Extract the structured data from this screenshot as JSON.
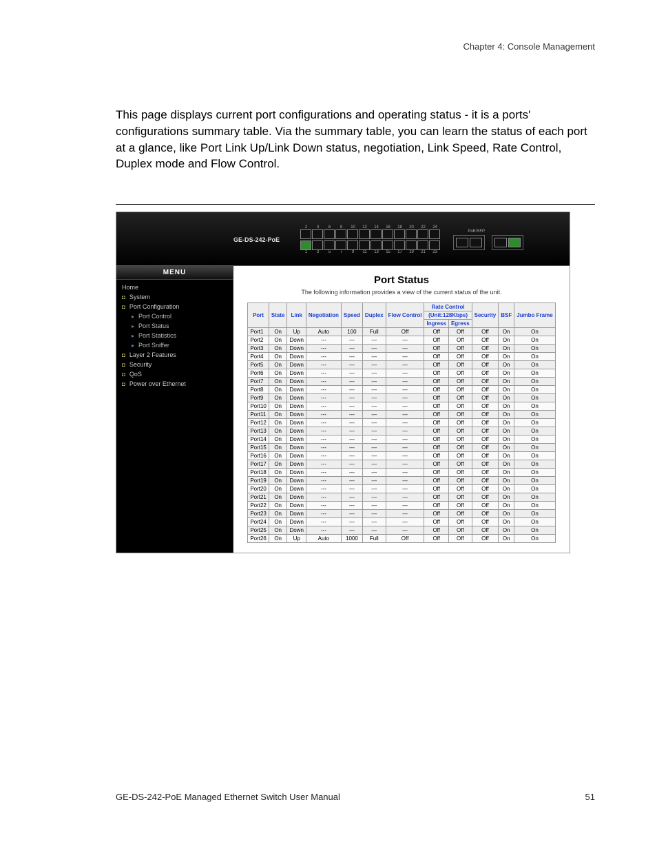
{
  "chapter_header": "Chapter 4: Console Management",
  "body_paragraph": "This page displays current port configurations and operating status - it is a ports' configurations summary table. Via the summary table, you can learn the status of each port at a glance, like Port Link Up/Link Down status, negotiation, Link Speed, Rate Control, Duplex mode and Flow Control.",
  "device_model": "GE-DS-242-PoE",
  "top_port_numbers": [
    "2",
    "4",
    "6",
    "8",
    "10",
    "12",
    "14",
    "16",
    "18",
    "20",
    "22",
    "24"
  ],
  "bottom_port_numbers": [
    "1",
    "3",
    "5",
    "7",
    "9",
    "11",
    "13",
    "15",
    "17",
    "19",
    "21",
    "23"
  ],
  "sfp_label": "PoE/SFP",
  "menu": {
    "title": "MENU",
    "items": [
      {
        "label": "Home",
        "type": "top"
      },
      {
        "label": "System",
        "type": "top",
        "bullet": "sq"
      },
      {
        "label": "Port Configuration",
        "type": "top",
        "bullet": "sq"
      },
      {
        "label": "Port Control",
        "type": "sub",
        "bullet": "tri"
      },
      {
        "label": "Port Status",
        "type": "sub",
        "bullet": "tri"
      },
      {
        "label": "Port Statistics",
        "type": "sub",
        "bullet": "tri"
      },
      {
        "label": "Port Sniffer",
        "type": "sub",
        "bullet": "tri"
      },
      {
        "label": "Layer 2 Features",
        "type": "top",
        "bullet": "sq"
      },
      {
        "label": "Security",
        "type": "top",
        "bullet": "sq"
      },
      {
        "label": "QoS",
        "type": "top",
        "bullet": "sq"
      },
      {
        "label": "Power over Ethernet",
        "type": "top",
        "bullet": "sq"
      }
    ]
  },
  "content": {
    "title": "Port Status",
    "subtitle": "The following information provides a view of the current status of the unit.",
    "headers": {
      "port": "Port",
      "state": "State",
      "link": "Link",
      "negotiation": "Negotiation",
      "speed": "Speed",
      "duplex": "Duplex",
      "flow": "Flow Control",
      "rate_group": "Rate Control",
      "rate_unit": "(Unit:128Kbps)",
      "ingress": "Ingress",
      "egress": "Egress",
      "security": "Security",
      "bsf": "BSF",
      "jumbo": "Jumbo Frame"
    },
    "rows": [
      {
        "port": "Port1",
        "state": "On",
        "link": "Up",
        "neg": "Auto",
        "speed": "100",
        "duplex": "Full",
        "flow": "Off",
        "ing": "Off",
        "egr": "Off",
        "sec": "Off",
        "bsf": "On",
        "jumbo": "On"
      },
      {
        "port": "Port2",
        "state": "On",
        "link": "Down",
        "neg": "---",
        "speed": "---",
        "duplex": "---",
        "flow": "---",
        "ing": "Off",
        "egr": "Off",
        "sec": "Off",
        "bsf": "On",
        "jumbo": "On"
      },
      {
        "port": "Port3",
        "state": "On",
        "link": "Down",
        "neg": "---",
        "speed": "---",
        "duplex": "---",
        "flow": "---",
        "ing": "Off",
        "egr": "Off",
        "sec": "Off",
        "bsf": "On",
        "jumbo": "On"
      },
      {
        "port": "Port4",
        "state": "On",
        "link": "Down",
        "neg": "---",
        "speed": "---",
        "duplex": "---",
        "flow": "---",
        "ing": "Off",
        "egr": "Off",
        "sec": "Off",
        "bsf": "On",
        "jumbo": "On"
      },
      {
        "port": "Port5",
        "state": "On",
        "link": "Down",
        "neg": "---",
        "speed": "---",
        "duplex": "---",
        "flow": "---",
        "ing": "Off",
        "egr": "Off",
        "sec": "Off",
        "bsf": "On",
        "jumbo": "On"
      },
      {
        "port": "Port6",
        "state": "On",
        "link": "Down",
        "neg": "---",
        "speed": "---",
        "duplex": "---",
        "flow": "---",
        "ing": "Off",
        "egr": "Off",
        "sec": "Off",
        "bsf": "On",
        "jumbo": "On"
      },
      {
        "port": "Port7",
        "state": "On",
        "link": "Down",
        "neg": "---",
        "speed": "---",
        "duplex": "---",
        "flow": "---",
        "ing": "Off",
        "egr": "Off",
        "sec": "Off",
        "bsf": "On",
        "jumbo": "On"
      },
      {
        "port": "Port8",
        "state": "On",
        "link": "Down",
        "neg": "---",
        "speed": "---",
        "duplex": "---",
        "flow": "---",
        "ing": "Off",
        "egr": "Off",
        "sec": "Off",
        "bsf": "On",
        "jumbo": "On"
      },
      {
        "port": "Port9",
        "state": "On",
        "link": "Down",
        "neg": "---",
        "speed": "---",
        "duplex": "---",
        "flow": "---",
        "ing": "Off",
        "egr": "Off",
        "sec": "Off",
        "bsf": "On",
        "jumbo": "On"
      },
      {
        "port": "Port10",
        "state": "On",
        "link": "Down",
        "neg": "---",
        "speed": "---",
        "duplex": "---",
        "flow": "---",
        "ing": "Off",
        "egr": "Off",
        "sec": "Off",
        "bsf": "On",
        "jumbo": "On"
      },
      {
        "port": "Port11",
        "state": "On",
        "link": "Down",
        "neg": "---",
        "speed": "---",
        "duplex": "---",
        "flow": "---",
        "ing": "Off",
        "egr": "Off",
        "sec": "Off",
        "bsf": "On",
        "jumbo": "On"
      },
      {
        "port": "Port12",
        "state": "On",
        "link": "Down",
        "neg": "---",
        "speed": "---",
        "duplex": "---",
        "flow": "---",
        "ing": "Off",
        "egr": "Off",
        "sec": "Off",
        "bsf": "On",
        "jumbo": "On"
      },
      {
        "port": "Port13",
        "state": "On",
        "link": "Down",
        "neg": "---",
        "speed": "---",
        "duplex": "---",
        "flow": "---",
        "ing": "Off",
        "egr": "Off",
        "sec": "Off",
        "bsf": "On",
        "jumbo": "On"
      },
      {
        "port": "Port14",
        "state": "On",
        "link": "Down",
        "neg": "---",
        "speed": "---",
        "duplex": "---",
        "flow": "---",
        "ing": "Off",
        "egr": "Off",
        "sec": "Off",
        "bsf": "On",
        "jumbo": "On"
      },
      {
        "port": "Port15",
        "state": "On",
        "link": "Down",
        "neg": "---",
        "speed": "---",
        "duplex": "---",
        "flow": "---",
        "ing": "Off",
        "egr": "Off",
        "sec": "Off",
        "bsf": "On",
        "jumbo": "On"
      },
      {
        "port": "Port16",
        "state": "On",
        "link": "Down",
        "neg": "---",
        "speed": "---",
        "duplex": "---",
        "flow": "---",
        "ing": "Off",
        "egr": "Off",
        "sec": "Off",
        "bsf": "On",
        "jumbo": "On"
      },
      {
        "port": "Port17",
        "state": "On",
        "link": "Down",
        "neg": "---",
        "speed": "---",
        "duplex": "---",
        "flow": "---",
        "ing": "Off",
        "egr": "Off",
        "sec": "Off",
        "bsf": "On",
        "jumbo": "On"
      },
      {
        "port": "Port18",
        "state": "On",
        "link": "Down",
        "neg": "---",
        "speed": "---",
        "duplex": "---",
        "flow": "---",
        "ing": "Off",
        "egr": "Off",
        "sec": "Off",
        "bsf": "On",
        "jumbo": "On"
      },
      {
        "port": "Port19",
        "state": "On",
        "link": "Down",
        "neg": "---",
        "speed": "---",
        "duplex": "---",
        "flow": "---",
        "ing": "Off",
        "egr": "Off",
        "sec": "Off",
        "bsf": "On",
        "jumbo": "On"
      },
      {
        "port": "Port20",
        "state": "On",
        "link": "Down",
        "neg": "---",
        "speed": "---",
        "duplex": "---",
        "flow": "---",
        "ing": "Off",
        "egr": "Off",
        "sec": "Off",
        "bsf": "On",
        "jumbo": "On"
      },
      {
        "port": "Port21",
        "state": "On",
        "link": "Down",
        "neg": "---",
        "speed": "---",
        "duplex": "---",
        "flow": "---",
        "ing": "Off",
        "egr": "Off",
        "sec": "Off",
        "bsf": "On",
        "jumbo": "On"
      },
      {
        "port": "Port22",
        "state": "On",
        "link": "Down",
        "neg": "---",
        "speed": "---",
        "duplex": "---",
        "flow": "---",
        "ing": "Off",
        "egr": "Off",
        "sec": "Off",
        "bsf": "On",
        "jumbo": "On"
      },
      {
        "port": "Port23",
        "state": "On",
        "link": "Down",
        "neg": "---",
        "speed": "---",
        "duplex": "---",
        "flow": "---",
        "ing": "Off",
        "egr": "Off",
        "sec": "Off",
        "bsf": "On",
        "jumbo": "On"
      },
      {
        "port": "Port24",
        "state": "On",
        "link": "Down",
        "neg": "---",
        "speed": "---",
        "duplex": "---",
        "flow": "---",
        "ing": "Off",
        "egr": "Off",
        "sec": "Off",
        "bsf": "On",
        "jumbo": "On"
      },
      {
        "port": "Port25",
        "state": "On",
        "link": "Down",
        "neg": "---",
        "speed": "---",
        "duplex": "---",
        "flow": "---",
        "ing": "Off",
        "egr": "Off",
        "sec": "Off",
        "bsf": "On",
        "jumbo": "On"
      },
      {
        "port": "Port26",
        "state": "On",
        "link": "Up",
        "neg": "Auto",
        "speed": "1000",
        "duplex": "Full",
        "flow": "Off",
        "ing": "Off",
        "egr": "Off",
        "sec": "Off",
        "bsf": "On",
        "jumbo": "On"
      }
    ]
  },
  "footer": {
    "left": "GE-DS-242-PoE Managed Ethernet Switch User Manual",
    "right": "51"
  }
}
